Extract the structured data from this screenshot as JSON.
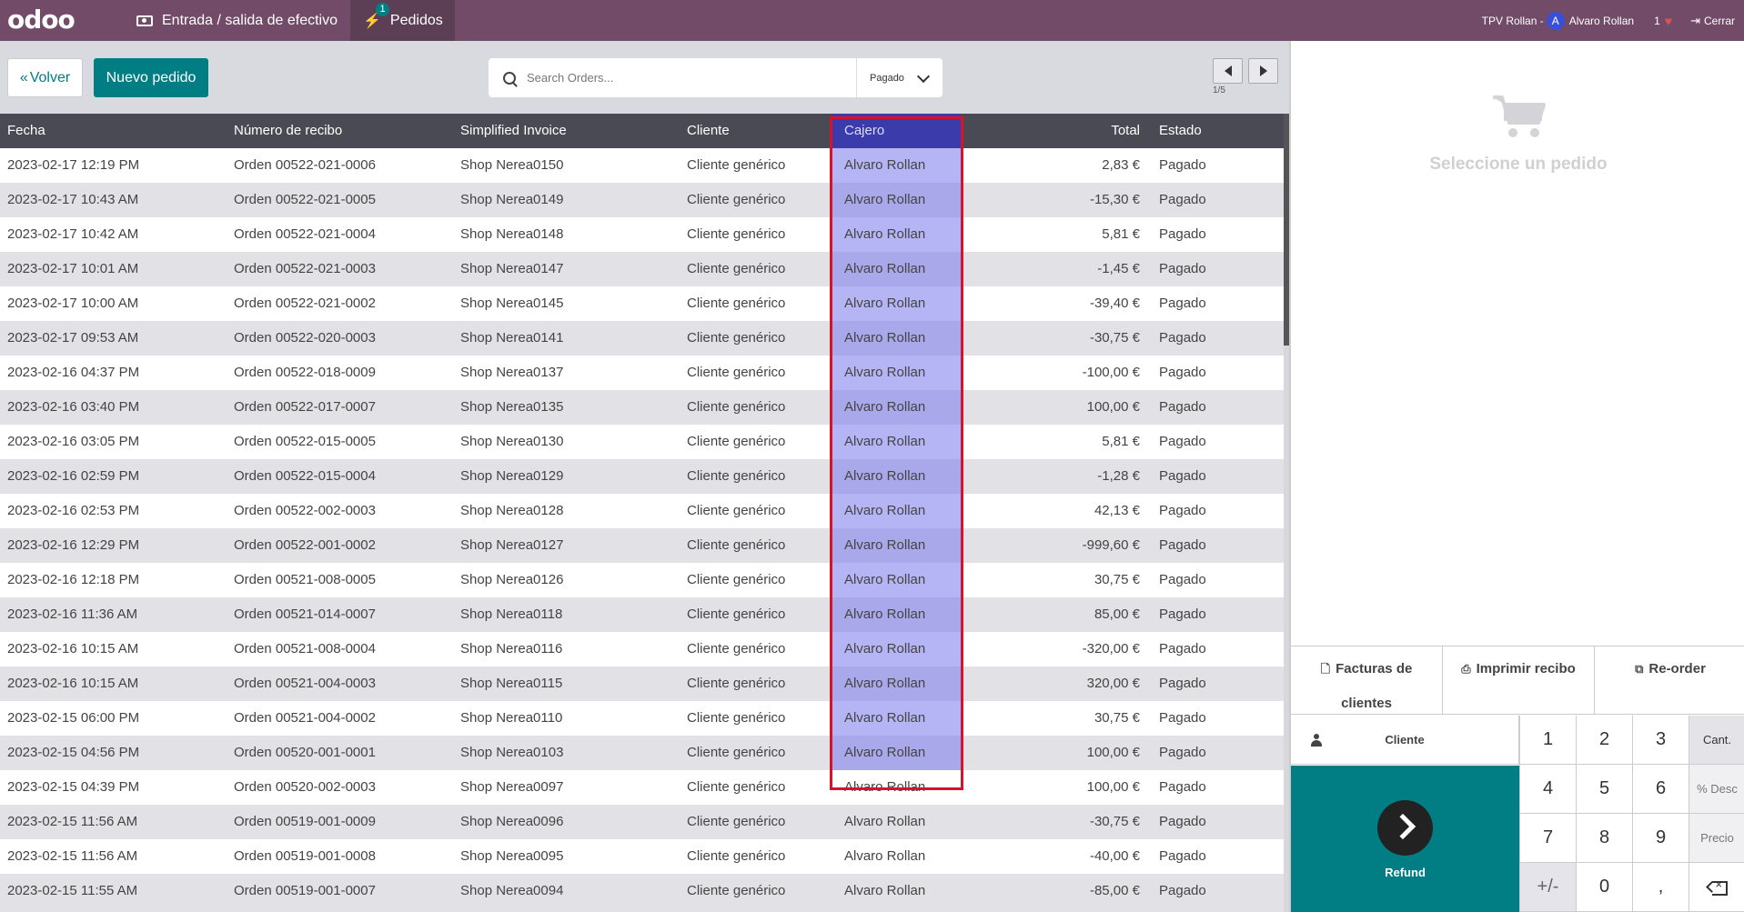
{
  "topbar": {
    "logo": "odoo",
    "cash_label": "Entrada / salida de efectivo",
    "orders_label": "Pedidos",
    "orders_badge": "1",
    "pos_name": "TPV Rollan -",
    "avatar_initial": "A",
    "user_name": "Alvaro Rollan",
    "notification_count": "1",
    "close_label": "Cerrar"
  },
  "controls": {
    "back_label": "Volver",
    "new_order_label": "Nuevo pedido",
    "search_placeholder": "Search Orders...",
    "filter_value": "Pagado",
    "pager_text": "1/5"
  },
  "table": {
    "headers": [
      "Fecha",
      "Número de recibo",
      "Simplified Invoice",
      "Cliente",
      "Cajero",
      "Total",
      "Estado"
    ],
    "rows": [
      [
        "2023-02-17 12:19 PM",
        "Orden 00522-021-0006",
        "Shop Nerea0150",
        "Cliente genérico",
        "Alvaro Rollan",
        "2,83 €",
        "Pagado"
      ],
      [
        "2023-02-17 10:43 AM",
        "Orden 00522-021-0005",
        "Shop Nerea0149",
        "Cliente genérico",
        "Alvaro Rollan",
        "-15,30 €",
        "Pagado"
      ],
      [
        "2023-02-17 10:42 AM",
        "Orden 00522-021-0004",
        "Shop Nerea0148",
        "Cliente genérico",
        "Alvaro Rollan",
        "5,81 €",
        "Pagado"
      ],
      [
        "2023-02-17 10:01 AM",
        "Orden 00522-021-0003",
        "Shop Nerea0147",
        "Cliente genérico",
        "Alvaro Rollan",
        "-1,45 €",
        "Pagado"
      ],
      [
        "2023-02-17 10:00 AM",
        "Orden 00522-021-0002",
        "Shop Nerea0145",
        "Cliente genérico",
        "Alvaro Rollan",
        "-39,40 €",
        "Pagado"
      ],
      [
        "2023-02-17 09:53 AM",
        "Orden 00522-020-0003",
        "Shop Nerea0141",
        "Cliente genérico",
        "Alvaro Rollan",
        "-30,75 €",
        "Pagado"
      ],
      [
        "2023-02-16 04:37 PM",
        "Orden 00522-018-0009",
        "Shop Nerea0137",
        "Cliente genérico",
        "Alvaro Rollan",
        "-100,00 €",
        "Pagado"
      ],
      [
        "2023-02-16 03:40 PM",
        "Orden 00522-017-0007",
        "Shop Nerea0135",
        "Cliente genérico",
        "Alvaro Rollan",
        "100,00 €",
        "Pagado"
      ],
      [
        "2023-02-16 03:05 PM",
        "Orden 00522-015-0005",
        "Shop Nerea0130",
        "Cliente genérico",
        "Alvaro Rollan",
        "5,81 €",
        "Pagado"
      ],
      [
        "2023-02-16 02:59 PM",
        "Orden 00522-015-0004",
        "Shop Nerea0129",
        "Cliente genérico",
        "Alvaro Rollan",
        "-1,28 €",
        "Pagado"
      ],
      [
        "2023-02-16 02:53 PM",
        "Orden 00522-002-0003",
        "Shop Nerea0128",
        "Cliente genérico",
        "Alvaro Rollan",
        "42,13 €",
        "Pagado"
      ],
      [
        "2023-02-16 12:29 PM",
        "Orden 00522-001-0002",
        "Shop Nerea0127",
        "Cliente genérico",
        "Alvaro Rollan",
        "-999,60 €",
        "Pagado"
      ],
      [
        "2023-02-16 12:18 PM",
        "Orden 00521-008-0005",
        "Shop Nerea0126",
        "Cliente genérico",
        "Alvaro Rollan",
        "30,75 €",
        "Pagado"
      ],
      [
        "2023-02-16 11:36 AM",
        "Orden 00521-014-0007",
        "Shop Nerea0118",
        "Cliente genérico",
        "Alvaro Rollan",
        "85,00 €",
        "Pagado"
      ],
      [
        "2023-02-16 10:15 AM",
        "Orden 00521-008-0004",
        "Shop Nerea0116",
        "Cliente genérico",
        "Alvaro Rollan",
        "-320,00 €",
        "Pagado"
      ],
      [
        "2023-02-16 10:15 AM",
        "Orden 00521-004-0003",
        "Shop Nerea0115",
        "Cliente genérico",
        "Alvaro Rollan",
        "320,00 €",
        "Pagado"
      ],
      [
        "2023-02-15 06:00 PM",
        "Orden 00521-004-0002",
        "Shop Nerea0110",
        "Cliente genérico",
        "Alvaro Rollan",
        "30,75 €",
        "Pagado"
      ],
      [
        "2023-02-15 04:56 PM",
        "Orden 00520-001-0001",
        "Shop Nerea0103",
        "Cliente genérico",
        "Alvaro Rollan",
        "100,00 €",
        "Pagado"
      ],
      [
        "2023-02-15 04:39 PM",
        "Orden 00520-002-0003",
        "Shop Nerea0097",
        "Cliente genérico",
        "Alvaro Rollan",
        "100,00 €",
        "Pagado"
      ],
      [
        "2023-02-15 11:56 AM",
        "Orden 00519-001-0009",
        "Shop Nerea0096",
        "Cliente genérico",
        "Alvaro Rollan",
        "-30,75 €",
        "Pagado"
      ],
      [
        "2023-02-15 11:56 AM",
        "Orden 00519-001-0008",
        "Shop Nerea0095",
        "Cliente genérico",
        "Alvaro Rollan",
        "-40,00 €",
        "Pagado"
      ],
      [
        "2023-02-15 11:55 AM",
        "Orden 00519-001-0007",
        "Shop Nerea0094",
        "Cliente genérico",
        "Alvaro Rollan",
        "-85,00 €",
        "Pagado"
      ]
    ],
    "highlighted_column": "Cajero",
    "highlight_color": "#d6132a"
  },
  "right_panel": {
    "empty_label": "Seleccione un pedido",
    "actions": {
      "invoices_line1": "Facturas de",
      "invoices_line2": "clientes",
      "print_label": "Imprimir recibo",
      "reorder_label": "Re-order"
    },
    "numpad": {
      "client_label": "Cliente",
      "refund_label": "Refund",
      "keys": [
        "1",
        "2",
        "3",
        "4",
        "5",
        "6",
        "7",
        "8",
        "9",
        "+/-",
        "0",
        ","
      ],
      "modes": [
        "Cant.",
        "% Desc",
        "Precio"
      ]
    }
  },
  "colors": {
    "topbar": "#714b67",
    "accent": "#017e84",
    "table_header": "#4a4a55"
  }
}
